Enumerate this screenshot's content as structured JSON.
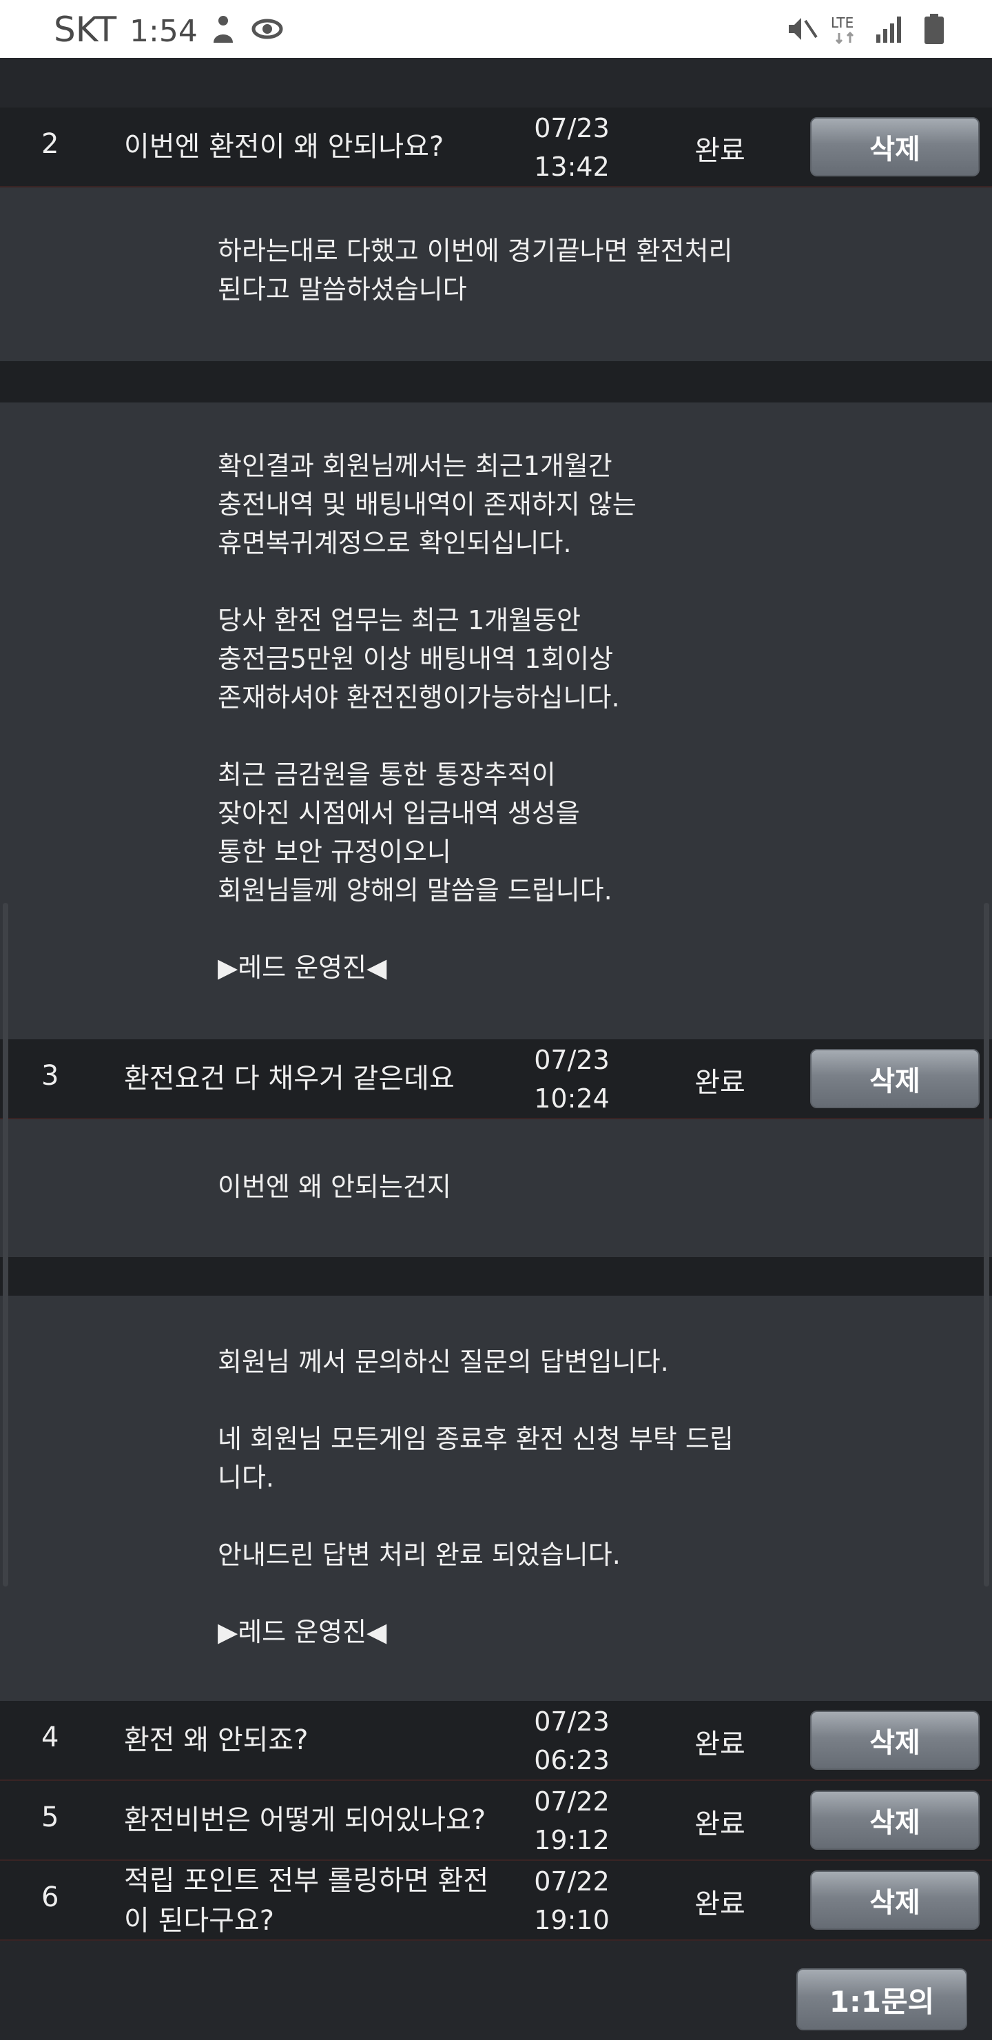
{
  "status_bar": {
    "carrier": "SKT",
    "time": "1:54",
    "network": "LTE"
  },
  "rows": [
    {
      "num": "2",
      "title": "이번엔 환전이 왜 안되나요?",
      "date": "07/23",
      "time": "13:42",
      "status": "완료",
      "delete_label": "삭제"
    },
    {
      "num": "3",
      "title": "환전요건 다 채우거 같은데요",
      "date": "07/23",
      "time": "10:24",
      "status": "완료",
      "delete_label": "삭제"
    },
    {
      "num": "4",
      "title": "환전 왜 안되죠?",
      "date": "07/23",
      "time": "06:23",
      "status": "완료",
      "delete_label": "삭제"
    },
    {
      "num": "5",
      "title": "환전비번은 어떻게 되어있나요?",
      "date": "07/22",
      "time": "19:12",
      "status": "완료",
      "delete_label": "삭제"
    },
    {
      "num": "6",
      "title": "적립 포인트 전부 롤링하면 환전이 된다구요?",
      "date": "07/22",
      "time": "19:10",
      "status": "완료",
      "delete_label": "삭제"
    }
  ],
  "panels": {
    "q2_question": "하라는대로 다했고 이번에 경기끝나면 환전처리\n된다고 말씀하셨습니다",
    "q2_answer": "확인결과 회원님께서는 최근1개월간\n충전내역 및 배팅내역이 존재하지 않는\n휴면복귀계정으로 확인되십니다.\n\n당사 환전 업무는 최근 1개월동안\n충전금5만원 이상 배팅내역 1회이상\n존재하셔야 환전진행이가능하십니다.\n\n최근 금감원을 통한 통장추적이\n잦아진 시점에서 입금내역 생성을\n통한 보안 규정이오니\n회원님들께 양해의 말씀을 드립니다.\n\n▶레드 운영진◀",
    "q3_question": "이번엔 왜 안되는건지",
    "q3_answer": "회원님 께서 문의하신 질문의 답변입니다.\n\n네 회원님 모든게임 종료후 환전 신청 부탁 드립\n니다.\n\n안내드린 답변 처리 완료 되었습니다.\n\n▶레드 운영진◀"
  },
  "inquiry_button": "1:1문의"
}
